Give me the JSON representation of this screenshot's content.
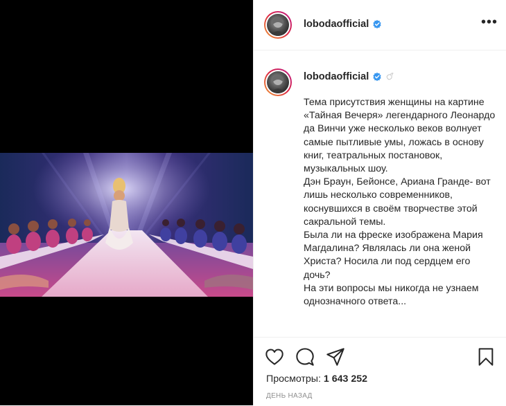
{
  "post": {
    "username": "lobodaofficial",
    "caption_username": "lobodaofficial",
    "caption_paragraphs": [
      "Тема присутствия женщины на картине «Тайная Вечеря» легендарного Леонардо да Винчи уже несколько веков волнует самые пытливые умы, ложась в основу книг, театральных постановок, музыкальных шоу.",
      "Дэн Браун, Бейонсе, Ариана Гранде- вот лишь несколько современников, коснувшихся в своём творчестве этой сакральной темы.",
      "Была ли на фреске изображена Мария Магдалина? Являлась ли она женой Христа? Носила ли под сердцем его дочь?",
      "На эти вопросы мы никогда не узнаем однозначного ответа..."
    ],
    "more_label": "•••",
    "views_label": "Просмотры:",
    "views_count": "1 643 252",
    "timestamp": "ДЕНЬ НАЗАД"
  },
  "icons": {
    "verified": "verified-badge-icon",
    "dove": "dove-emoji-icon",
    "like": "heart-icon",
    "comment": "comment-icon",
    "share": "paper-plane-icon",
    "save": "bookmark-icon"
  },
  "colors": {
    "verified": "#3897f0",
    "ring_start": "#f09433",
    "ring_end": "#bc1888",
    "muted": "#8e8e8e"
  }
}
